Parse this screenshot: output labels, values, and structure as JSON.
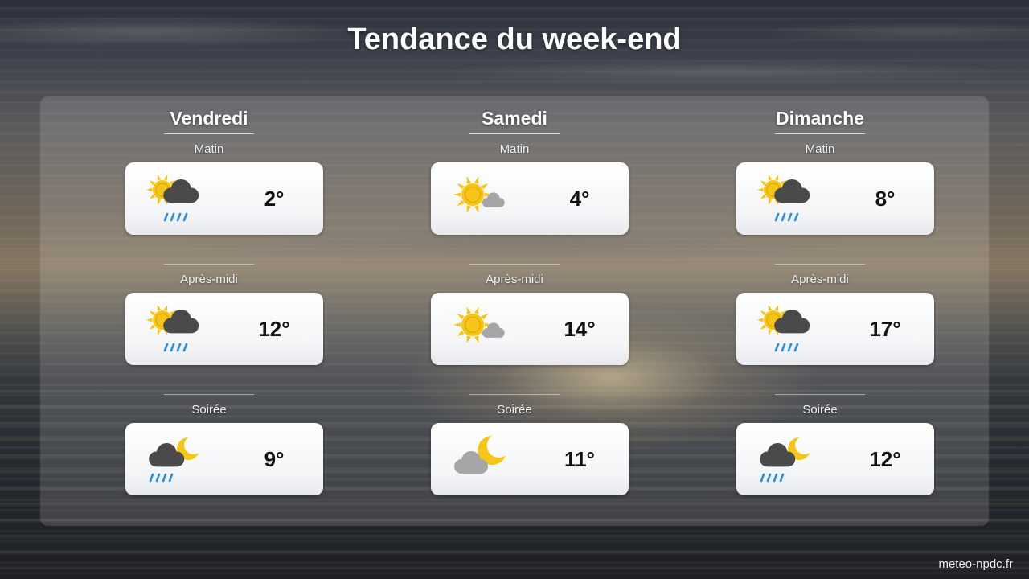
{
  "title": "Tendance du week-end",
  "footer": "meteo-npdc.fr",
  "colors": {
    "sun": "#f5c518",
    "moon": "#f5c518",
    "dark_cloud": "#4a4a4a",
    "light_cloud": "#a6a6a6",
    "rain": "#2b8ee0"
  },
  "days": [
    {
      "name": "Vendredi",
      "periods": [
        {
          "label": "Matin",
          "temp": "2°",
          "icon": "sun-cloud-rain-icon"
        },
        {
          "label": "Après-midi",
          "temp": "12°",
          "icon": "sun-cloud-rain-icon"
        },
        {
          "label": "Soirée",
          "temp": "9°",
          "icon": "moon-cloud-rain-icon"
        }
      ]
    },
    {
      "name": "Samedi",
      "periods": [
        {
          "label": "Matin",
          "temp": "4°",
          "icon": "sun-small-cloud-icon"
        },
        {
          "label": "Après-midi",
          "temp": "14°",
          "icon": "sun-small-cloud-icon"
        },
        {
          "label": "Soirée",
          "temp": "11°",
          "icon": "moon-cloud-icon"
        }
      ]
    },
    {
      "name": "Dimanche",
      "periods": [
        {
          "label": "Matin",
          "temp": "8°",
          "icon": "sun-cloud-rain-icon"
        },
        {
          "label": "Après-midi",
          "temp": "17°",
          "icon": "sun-cloud-rain-icon"
        },
        {
          "label": "Soirée",
          "temp": "12°",
          "icon": "moon-cloud-rain-icon"
        }
      ]
    }
  ]
}
